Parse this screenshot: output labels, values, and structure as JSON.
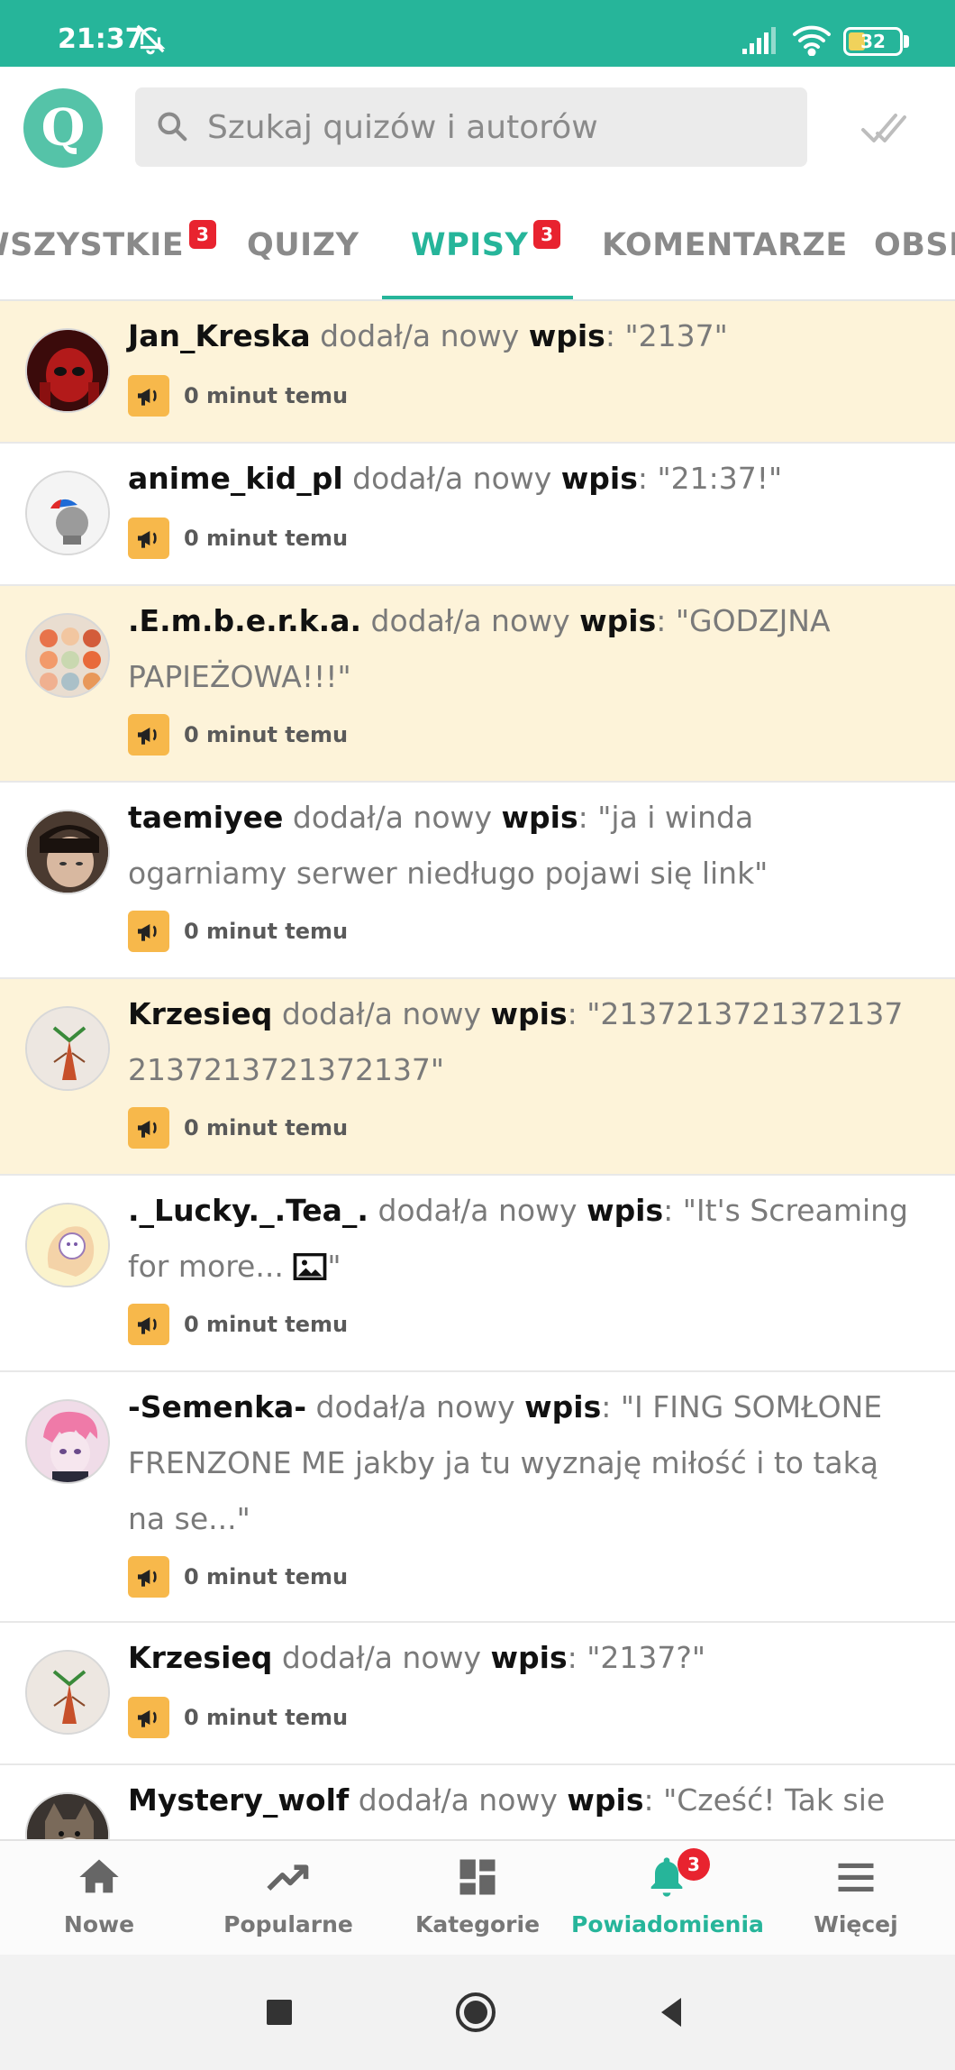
{
  "status_bar": {
    "time": "21:37",
    "battery": "32"
  },
  "logo_letter": "Q",
  "search": {
    "placeholder": "Szukaj quizów i autorów"
  },
  "tabs": [
    {
      "label": "WSZYSTKIE",
      "badge": "3"
    },
    {
      "label": "QUIZY"
    },
    {
      "label": "WPISY",
      "badge": "3",
      "active": true
    },
    {
      "label": "KOMENTARZE"
    },
    {
      "label": "OBSERWUJĄCY"
    }
  ],
  "notification_action": "dodał/a nowy",
  "notification_type": "wpis",
  "notifications": [
    {
      "author": "Jan_Kreska",
      "content": "\"2137\"",
      "time": "0 minut temu",
      "unread": true
    },
    {
      "author": "anime_kid_pl",
      "content": "\"21:37!\"",
      "time": "0 minut temu",
      "unread": false
    },
    {
      "author": ".E.m.b.e.r.k.a.",
      "content": "\"GODZJNA PAPIEŻOWA!!!\"",
      "time": "0 minut temu",
      "unread": true
    },
    {
      "author": "taemiyee",
      "content": "\"ja i winda ogarniamy serwer niedługo pojawi się link\"",
      "time": "0 minut temu",
      "unread": false
    },
    {
      "author": "Krzesieq",
      "content": "\"21372137213721372137213721372137\"",
      "time": "0 minut temu",
      "unread": true
    },
    {
      "author": "._Lucky._.Tea_.",
      "content": "\"It's Screaming for more... ",
      "content_end": "\"",
      "time": "0 minut temu",
      "unread": false
    },
    {
      "author": "-Semenka-",
      "content": "\"I FING SOMŁONE FRENZONE ME jakby ja tu wyznaję miłość i to taką na se...\"",
      "time": "0 minut temu",
      "unread": false
    },
    {
      "author": "Krzesieq",
      "content": "\"2137?\"",
      "time": "0 minut temu",
      "unread": false
    },
    {
      "author": "Mystery_wolf",
      "content": "\"Cześć! Tak sie",
      "time": "",
      "unread": false
    }
  ],
  "bottom_nav": [
    {
      "label": "Nowe",
      "icon": "home-icon"
    },
    {
      "label": "Popularne",
      "icon": "trending-icon"
    },
    {
      "label": "Kategorie",
      "icon": "grid-icon"
    },
    {
      "label": "Powiadomienia",
      "icon": "bell-icon",
      "badge": "3",
      "active": true
    },
    {
      "label": "Więcej",
      "icon": "menu-icon"
    }
  ],
  "colors": {
    "accent": "#26b59a",
    "unread_bg": "#fdf3d9",
    "badge": "#e8232f",
    "megaphone": "#f7b84b"
  }
}
